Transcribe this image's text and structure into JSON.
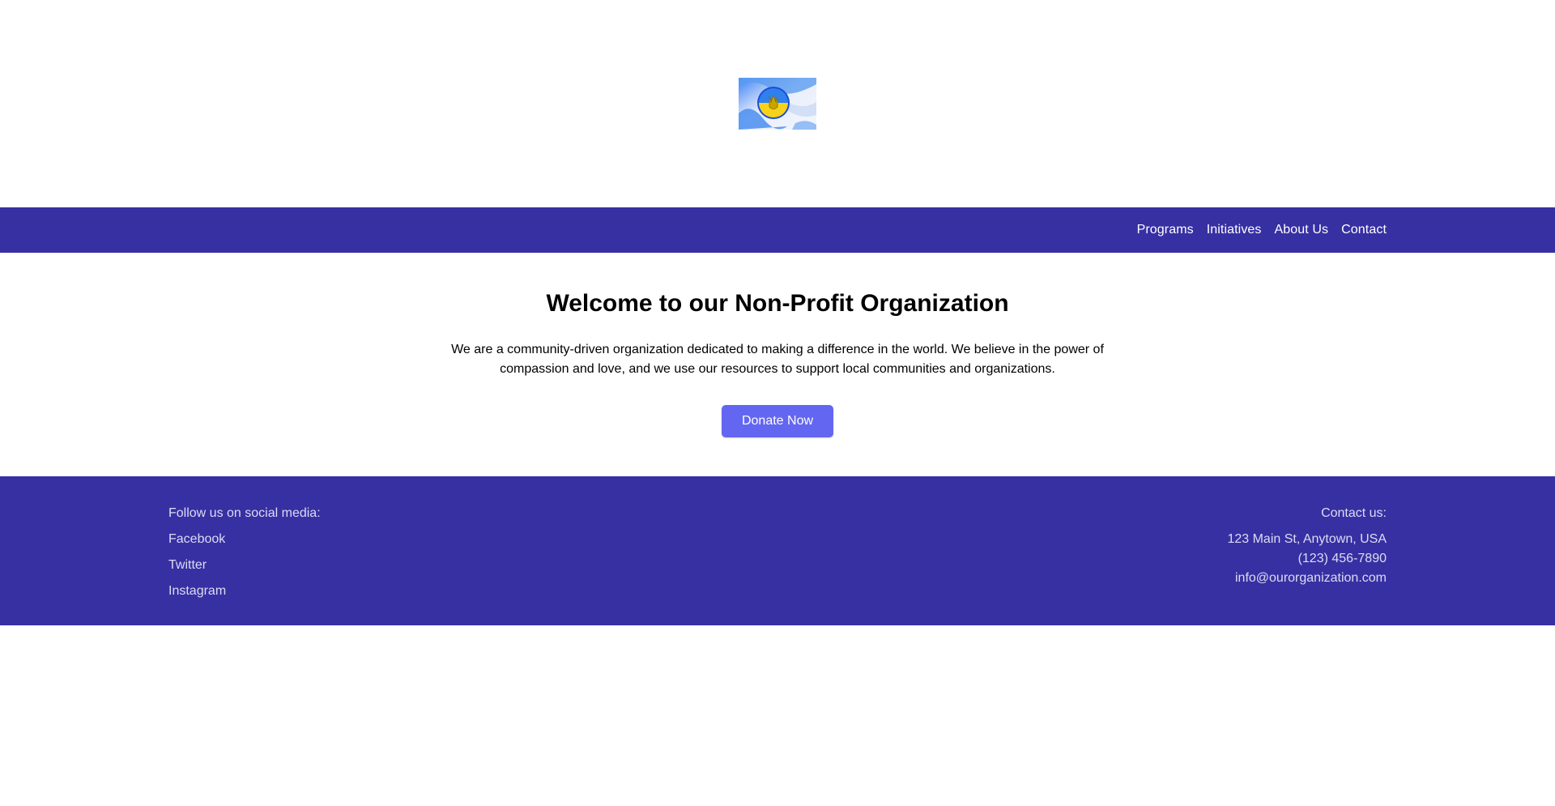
{
  "header": {
    "logo_icon": "ukraine-flag-badge-icon"
  },
  "nav": {
    "links": [
      "Programs",
      "Initiatives",
      "About Us",
      "Contact"
    ]
  },
  "hero": {
    "title": "Welcome to our Non-Profit Organization",
    "text": "We are a community-driven organization dedicated to making a difference in the world. We believe in the power of compassion and love, and we use our resources to support local communities and organizations.",
    "donate_label": "Donate Now"
  },
  "footer": {
    "social_heading": "Follow us on social media:",
    "social_links": [
      "Facebook",
      "Twitter",
      "Instagram"
    ],
    "contact_heading": "Contact us:",
    "address": "123 Main St, Anytown, USA",
    "phone": "(123) 456-7890",
    "email": "info@ourorganization.com"
  },
  "colors": {
    "brand": "#3730a3",
    "accent": "#6366f1",
    "footer_text": "#dcdcf2"
  }
}
